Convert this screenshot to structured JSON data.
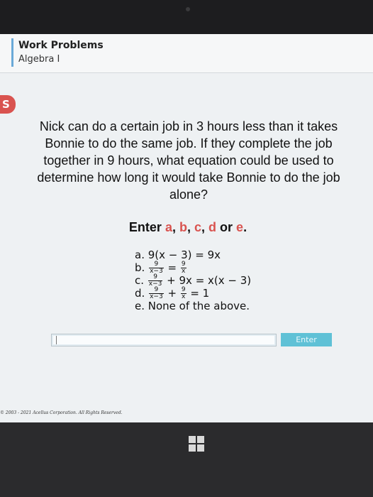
{
  "header": {
    "course_title": "Work Problems",
    "course_subtitle": "Algebra I"
  },
  "side_tab": {
    "label": "S"
  },
  "question": {
    "text": "Nick can do a certain job in 3 hours less than it takes Bonnie to do the same job. If they complete the job together in 9 hours, what equation could be used to determine how long it would take Bonnie to do the job alone?"
  },
  "instruction": {
    "prefix": "Enter ",
    "a": "a",
    "b": "b",
    "c": "c",
    "d": "d",
    "or": "or",
    "e": "e",
    "sep": ", ",
    "end": "."
  },
  "choices": {
    "a": {
      "letter": "a.",
      "text": "9(x − 3) = 9x"
    },
    "b": {
      "letter": "b.",
      "n1": "9",
      "d1": "x−3",
      "eq": "=",
      "n2": "9",
      "d2": "x"
    },
    "c": {
      "letter": "c.",
      "n1": "9",
      "d1": "x−3",
      "rest": "+ 9x = x(x − 3)"
    },
    "d": {
      "letter": "d.",
      "n1": "9",
      "d1": "x−3",
      "plus": "+",
      "n2": "9",
      "d2": "x",
      "rest": "= 1"
    },
    "e": {
      "letter": "e.",
      "text": "None of the above."
    }
  },
  "answer": {
    "value": "",
    "enter_label": "Enter"
  },
  "footer": {
    "copyright": "© 2003 - 2021 Acellus Corporation. All Rights Reserved."
  },
  "colors": {
    "accent_red": "#d9534f",
    "button_cyan": "#5fc1d6"
  },
  "icons": {
    "taskbar": "windows-logo-icon"
  }
}
